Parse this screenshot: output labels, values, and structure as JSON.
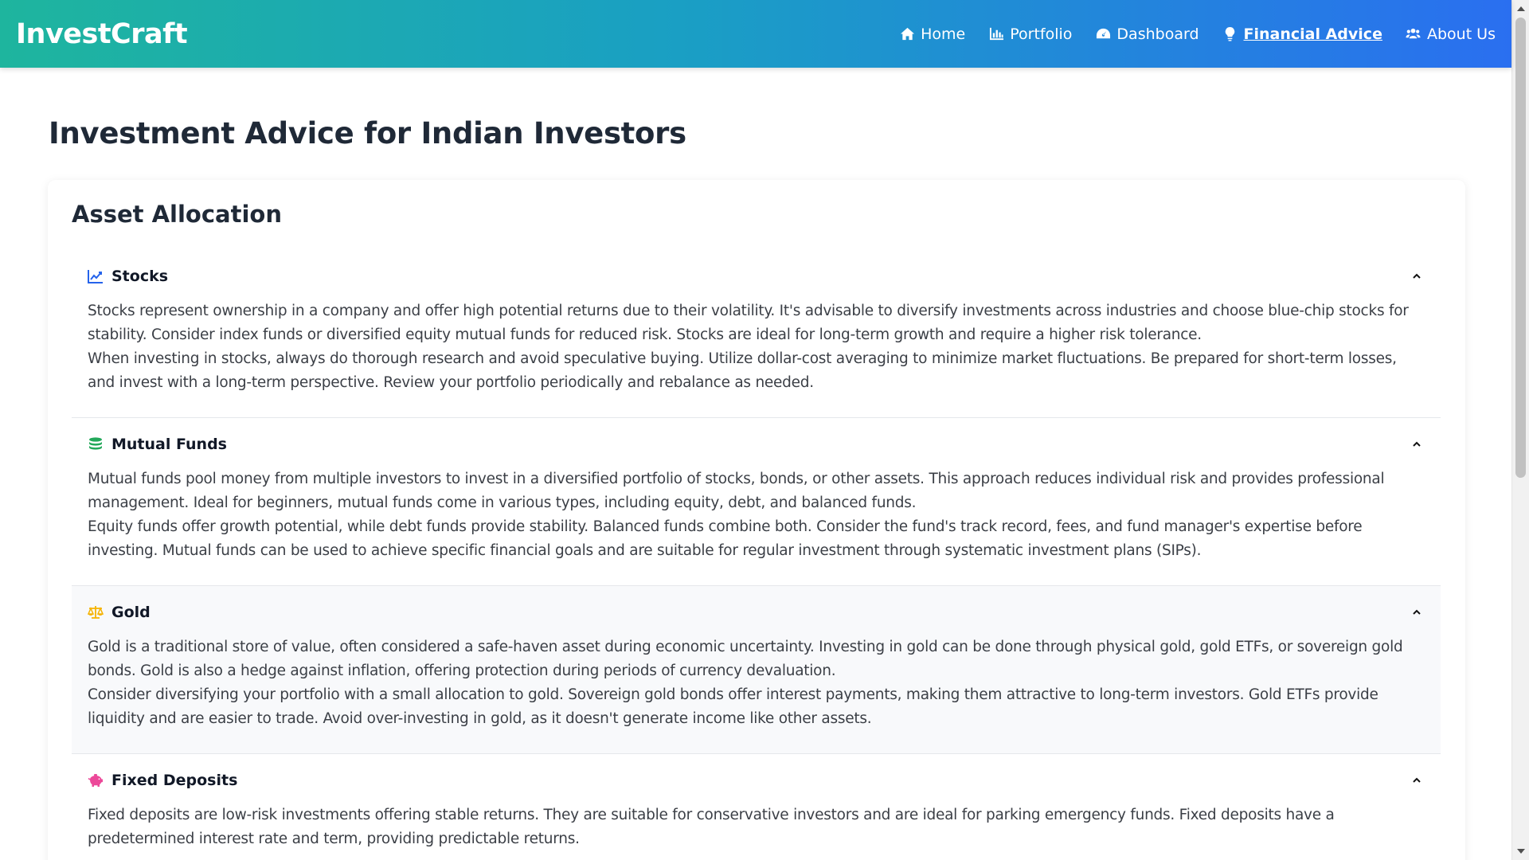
{
  "navbar": {
    "brand": "InvestCraft",
    "links": [
      {
        "label": "Home",
        "icon": "home-icon",
        "active": false
      },
      {
        "label": "Portfolio",
        "icon": "bar-chart-icon",
        "active": false
      },
      {
        "label": "Dashboard",
        "icon": "tachometer-icon",
        "active": false
      },
      {
        "label": "Financial Advice",
        "icon": "lightbulb-icon",
        "active": true
      },
      {
        "label": "About Us",
        "icon": "users-icon",
        "active": false
      }
    ]
  },
  "page": {
    "title": "Investment Advice for Indian Investors"
  },
  "allocation": {
    "title": "Asset Allocation",
    "items": [
      {
        "title": "Stocks",
        "icon": "line-chart-icon",
        "icon_color": "#2563eb",
        "paragraphs": [
          "Stocks represent ownership in a company and offer high potential returns due to their volatility. It's advisable to diversify investments across industries and choose blue-chip stocks for stability. Consider index funds or diversified equity mutual funds for reduced risk. Stocks are ideal for long-term growth and require a higher risk tolerance.",
          "When investing in stocks, always do thorough research and avoid speculative buying. Utilize dollar-cost averaging to minimize market fluctuations. Be prepared for short-term losses, and invest with a long-term perspective. Review your portfolio periodically and rebalance as needed."
        ]
      },
      {
        "title": "Mutual Funds",
        "icon": "coins-icon",
        "icon_color": "#22a85a",
        "paragraphs": [
          "Mutual funds pool money from multiple investors to invest in a diversified portfolio of stocks, bonds, or other assets. This approach reduces individual risk and provides professional management. Ideal for beginners, mutual funds come in various types, including equity, debt, and balanced funds.",
          "Equity funds offer growth potential, while debt funds provide stability. Balanced funds combine both. Consider the fund's track record, fees, and fund manager's expertise before investing. Mutual funds can be used to achieve specific financial goals and are suitable for regular investment through systematic investment plans (SIPs)."
        ]
      },
      {
        "title": "Gold",
        "icon": "balance-scale-icon",
        "icon_color": "#f5b301",
        "paragraphs": [
          "Gold is a traditional store of value, often considered a safe-haven asset during economic uncertainty. Investing in gold can be done through physical gold, gold ETFs, or sovereign gold bonds. Gold is also a hedge against inflation, offering protection during periods of currency devaluation.",
          "Consider diversifying your portfolio with a small allocation to gold. Sovereign gold bonds offer interest payments, making them attractive to long-term investors. Gold ETFs provide liquidity and are easier to trade. Avoid over-investing in gold, as it doesn't generate income like other assets."
        ]
      },
      {
        "title": "Fixed Deposits",
        "icon": "piggy-bank-icon",
        "icon_color": "#ec4899",
        "paragraphs": [
          "Fixed deposits are low-risk investments offering stable returns. They are suitable for conservative investors and are ideal for parking emergency funds. Fixed deposits have a predetermined interest rate and term, providing predictable returns."
        ]
      }
    ]
  }
}
